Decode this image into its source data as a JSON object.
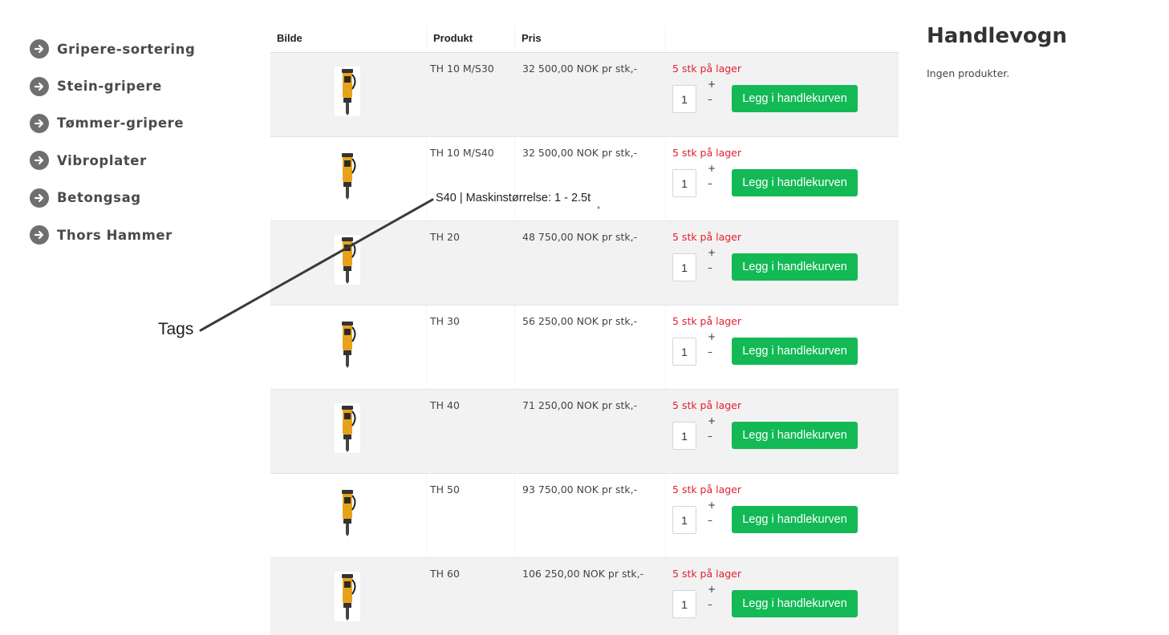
{
  "sidebar": {
    "items": [
      {
        "label": "Gripere-sortering",
        "icon": "arrow-right-circle-icon"
      },
      {
        "label": "Stein-gripere",
        "icon": "arrow-right-circle-icon"
      },
      {
        "label": "Tømmer-gripere",
        "icon": "arrow-right-circle-icon"
      },
      {
        "label": "Vibroplater",
        "icon": "arrow-right-circle-icon"
      },
      {
        "label": "Betongsag",
        "icon": "arrow-right-circle-icon"
      },
      {
        "label": "Thors Hammer",
        "icon": "arrow-right-circle-icon"
      }
    ]
  },
  "table": {
    "headers": [
      "Bilde",
      "Produkt",
      "Pris",
      ""
    ],
    "rows": [
      {
        "product": "TH 10 M/S30",
        "price": "32 500,00 NOK pr stk,-",
        "stock": "5 stk på lager",
        "qty": "1",
        "plus": "+",
        "minus": "–",
        "button": "Legg i handlekurven"
      },
      {
        "product": "TH 10 M/S40",
        "price": "32 500,00 NOK pr stk,-",
        "stock": "5 stk på lager",
        "qty": "1",
        "plus": "+",
        "minus": "–",
        "button": "Legg i handlekurven"
      },
      {
        "product": "TH 20",
        "price": "48 750,00 NOK pr stk,-",
        "stock": "5 stk på lager",
        "qty": "1",
        "plus": "+",
        "minus": "–",
        "button": "Legg i handlekurven"
      },
      {
        "product": "TH 30",
        "price": "56 250,00 NOK pr stk,-",
        "stock": "5 stk på lager",
        "qty": "1",
        "plus": "+",
        "minus": "–",
        "button": "Legg i handlekurven"
      },
      {
        "product": "TH 40",
        "price": "71 250,00 NOK pr stk,-",
        "stock": "5 stk på lager",
        "qty": "1",
        "plus": "+",
        "minus": "–",
        "button": "Legg i handlekurven"
      },
      {
        "product": "TH 50",
        "price": "93 750,00 NOK pr stk,-",
        "stock": "5 stk på lager",
        "qty": "1",
        "plus": "+",
        "minus": "–",
        "button": "Legg i handlekurven"
      },
      {
        "product": "TH 60",
        "price": "106 250,00 NOK pr stk,-",
        "stock": "5 stk på lager",
        "qty": "1",
        "plus": "+",
        "minus": "–",
        "button": "Legg i handlekurven"
      }
    ]
  },
  "cart": {
    "title": "Handlevogn",
    "empty_text": "Ingen produkter."
  },
  "annotation": {
    "tooltip_text": "S40 | Maskinstørrelse: 1 - 2.5t",
    "label": "Tags"
  },
  "colors": {
    "stock_red": "#e0212f",
    "button_green": "#13b955",
    "row_alt": "#f2f2f2",
    "sidebar_icon": "#6f6f6f"
  }
}
